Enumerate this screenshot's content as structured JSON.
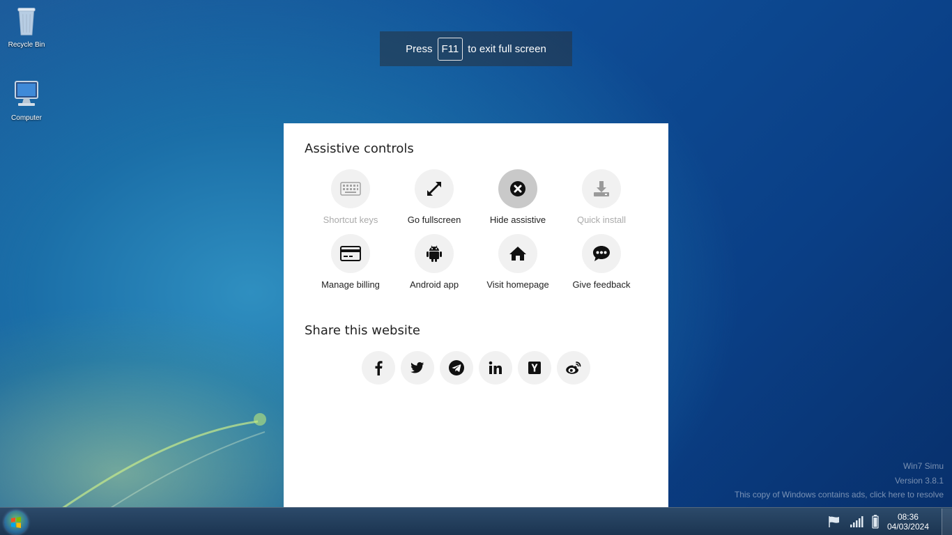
{
  "desktop": {
    "icons": [
      {
        "label": "Recycle Bin",
        "icon": "recycle-bin-icon"
      },
      {
        "label": "Computer",
        "icon": "computer-icon"
      }
    ]
  },
  "toast": {
    "before": "Press",
    "key": "F11",
    "after": "to exit full screen"
  },
  "modal": {
    "assistive_title": "Assistive controls",
    "controls": [
      {
        "label": "Shortcut keys",
        "icon": "keyboard-icon",
        "enabled": false
      },
      {
        "label": "Go fullscreen",
        "icon": "expand-icon",
        "enabled": true
      },
      {
        "label": "Hide assistive",
        "icon": "close-circle-icon",
        "enabled": true,
        "active": true
      },
      {
        "label": "Quick install",
        "icon": "download-icon",
        "enabled": false
      },
      {
        "label": "Manage billing",
        "icon": "credit-card-icon",
        "enabled": true
      },
      {
        "label": "Android app",
        "icon": "android-icon",
        "enabled": true
      },
      {
        "label": "Visit homepage",
        "icon": "home-icon",
        "enabled": true
      },
      {
        "label": "Give feedback",
        "icon": "chat-icon",
        "enabled": true
      }
    ],
    "share_title": "Share this website",
    "share": [
      {
        "icon": "facebook-icon"
      },
      {
        "icon": "twitter-icon"
      },
      {
        "icon": "telegram-icon"
      },
      {
        "icon": "linkedin-icon"
      },
      {
        "icon": "hacker-news-icon"
      },
      {
        "icon": "weibo-icon"
      }
    ]
  },
  "watermark": {
    "line1": "Win7 Simu",
    "line2": "Version 3.8.1",
    "line3": "This copy of Windows contains ads, click here to resolve"
  },
  "taskbar": {
    "time": "08:36",
    "date": "04/03/2024"
  }
}
